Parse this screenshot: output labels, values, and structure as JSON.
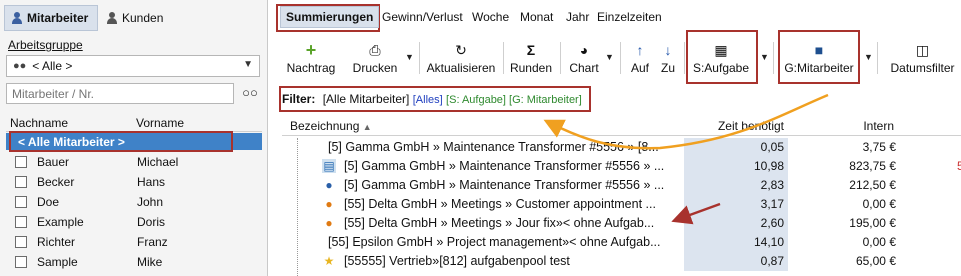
{
  "left": {
    "tabs": [
      {
        "label": "Mitarbeiter"
      },
      {
        "label": "Kunden"
      }
    ],
    "group_label": "Arbeitsgruppe",
    "group_value": "< Alle >",
    "search_placeholder": "Mitarbeiter / Nr.",
    "columns": [
      "Nachname",
      "Vorname"
    ],
    "selected": "< Alle Mitarbeiter >",
    "rows": [
      {
        "last": "Bauer",
        "first": "Michael"
      },
      {
        "last": "Becker",
        "first": "Hans"
      },
      {
        "last": "Doe",
        "first": "John"
      },
      {
        "last": "Example",
        "first": "Doris"
      },
      {
        "last": "Richter",
        "first": "Franz"
      },
      {
        "last": "Sample",
        "first": "Mike"
      }
    ]
  },
  "nav": {
    "tabs": [
      "Summierungen",
      "Gewinn/Verlust",
      "Woche",
      "Monat",
      "Jahr",
      "Einzelzeiten"
    ]
  },
  "toolbar": {
    "nachtrag": "Nachtrag",
    "drucken": "Drucken",
    "aktualisieren": "Aktualisieren",
    "runden": "Runden",
    "chart": "Chart",
    "auf": "Auf",
    "zu": "Zu",
    "s_aufgabe": "S:Aufgabe",
    "g_mitarbeiter": "G:Mitarbeiter",
    "datumsfilter": "Datumsfilter"
  },
  "filter": {
    "label": "Filter:",
    "value": "[Alle Mitarbeiter]",
    "alles": "[Alles]",
    "rest": "[S: Aufgabe] [G: Mitarbeiter]"
  },
  "table": {
    "columns": [
      "Bezeichnung",
      "Zeit benötigt",
      "Intern"
    ],
    "rows": [
      {
        "label": "[5] Gamma GmbH » Maintenance Transformer #5556 » [8...",
        "zeit": "0,05",
        "intern": "3,75 €",
        "icon": ""
      },
      {
        "label": "[5] Gamma GmbH » Maintenance Transformer #5556 » ...",
        "zeit": "10,98",
        "intern": "823,75 €",
        "icon": "chart-icon"
      },
      {
        "label": "[5] Gamma GmbH » Maintenance Transformer #5556 » ...",
        "zeit": "2,83",
        "intern": "212,50 €",
        "icon": "user-icon"
      },
      {
        "label": "[55] Delta GmbH » Meetings » Customer appointment ...",
        "zeit": "3,17",
        "intern": "0,00 €",
        "icon": "group-icon"
      },
      {
        "label": "[55] Delta GmbH » Meetings » Jour fix»< ohne Aufgab...",
        "zeit": "2,60",
        "intern": "195,00 €",
        "icon": "group-icon"
      },
      {
        "label": "[55] Epsilon GmbH » Project management»< ohne Aufgab...",
        "zeit": "14,10",
        "intern": "0,00 €",
        "icon": ""
      },
      {
        "label": "[55555] Vertrieb»[812] aufgabenpool test",
        "zeit": "0,87",
        "intern": "65,00 €",
        "icon": "star-icon"
      }
    ]
  },
  "colors": {
    "accent": "#3f82c8",
    "highlight": "#a8322d",
    "arrow_orange": "#f0a020",
    "green": "#2f8a2f",
    "blue": "#1f3fbf"
  }
}
